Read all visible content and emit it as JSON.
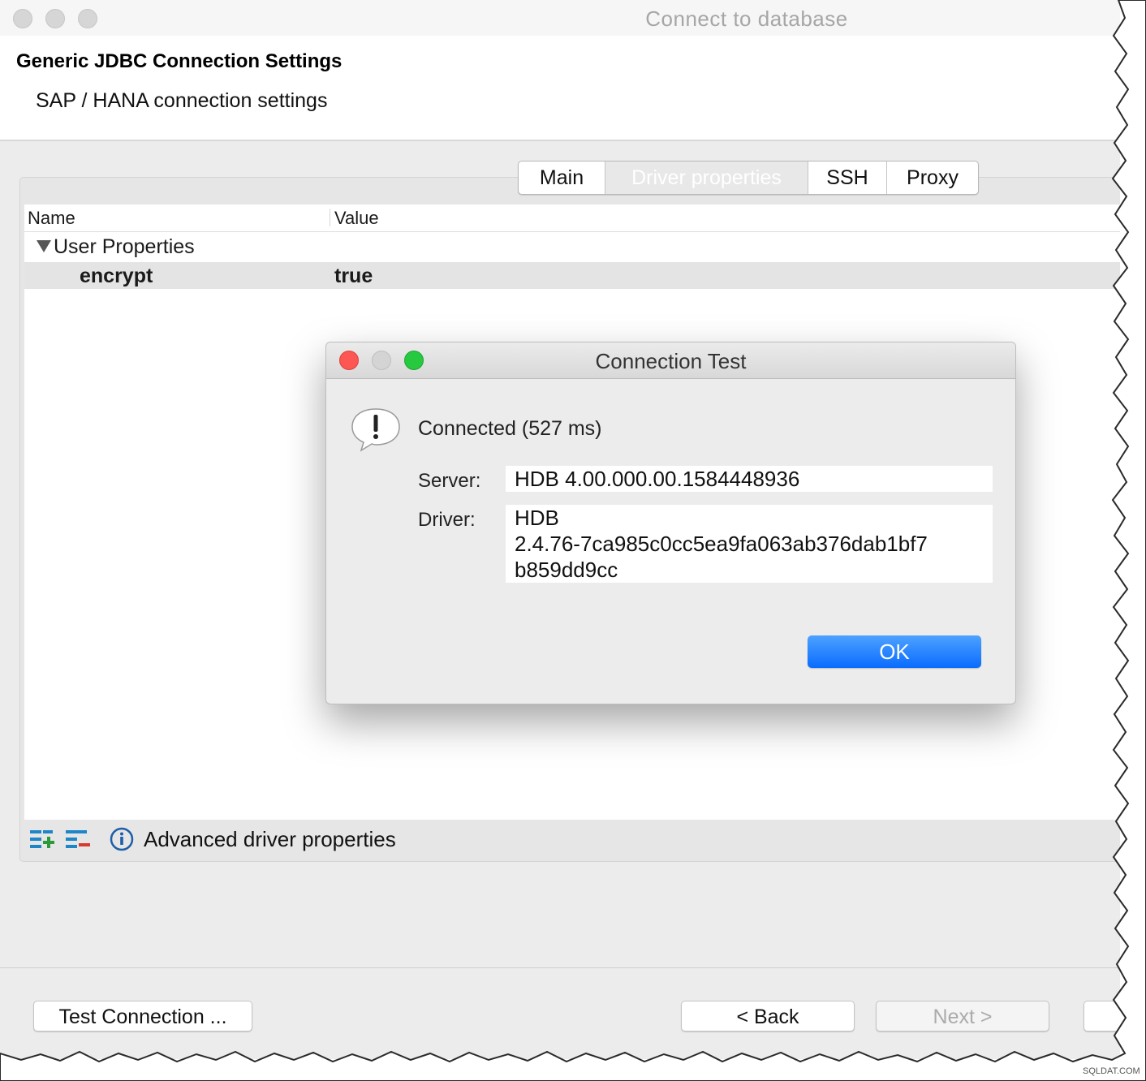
{
  "window": {
    "title": "Connect to database"
  },
  "header": {
    "title": "Generic JDBC Connection Settings",
    "subtitle": "SAP / HANA connection settings"
  },
  "tabs": [
    {
      "label": "Main"
    },
    {
      "label": "Driver properties"
    },
    {
      "label": "SSH"
    },
    {
      "label": "Proxy"
    }
  ],
  "table": {
    "columns": [
      "Name",
      "Value"
    ],
    "group": "User Properties",
    "rows": [
      {
        "name": "encrypt",
        "value": "true"
      }
    ]
  },
  "bottom_bar": {
    "label": "Advanced driver properties"
  },
  "footer": {
    "test_connection": "Test Connection ...",
    "back": "< Back",
    "next": "Next >"
  },
  "dialog": {
    "title": "Connection Test",
    "message": "Connected (527 ms)",
    "server_label": "Server:",
    "server_value": "HDB 4.00.000.00.1584448936",
    "driver_label": "Driver:",
    "driver_value_lines": [
      "HDB",
      "2.4.76-7ca985c0cc5ea9fa063ab376dab1bf7",
      "b859dd9cc"
    ],
    "ok": "OK"
  },
  "watermark": "SQLDAT.COM",
  "colors": {
    "ok_button": "#0a6cff",
    "close": "#fc5753",
    "zoom": "#27c93f",
    "add_icon": "#2a9a3a",
    "remove_icon": "#d93a2b",
    "info_icon": "#1d5fa8"
  }
}
